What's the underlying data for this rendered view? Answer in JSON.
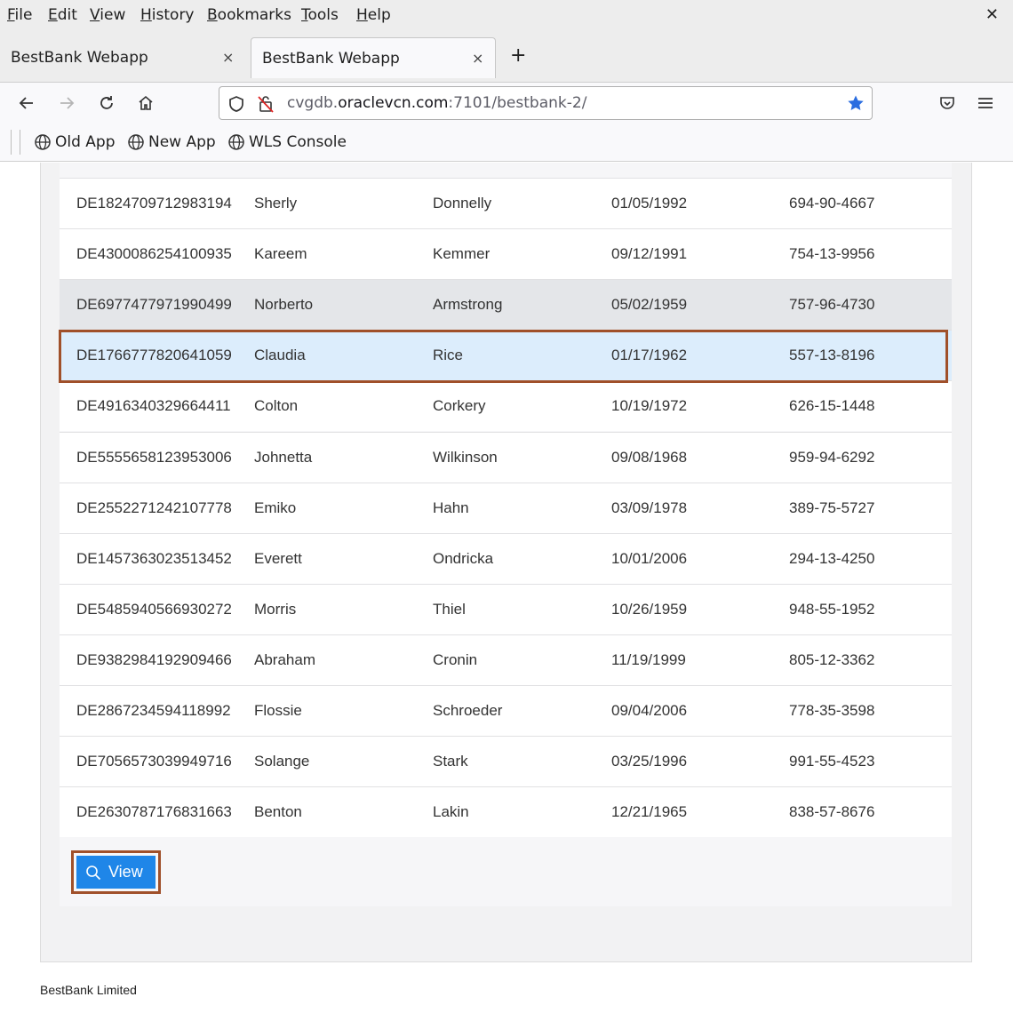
{
  "menubar": {
    "items": [
      "File",
      "Edit",
      "View",
      "History",
      "Bookmarks",
      "Tools",
      "Help"
    ],
    "close_glyph": "✕"
  },
  "tabs": [
    {
      "label": "BestBank Webapp",
      "active": false
    },
    {
      "label": "BestBank Webapp",
      "active": true
    }
  ],
  "tab_close_glyph": "×",
  "new_tab_glyph": "+",
  "urlbar": {
    "url_prefix": "cvgdb.",
    "url_host": "oraclevcn.com",
    "url_suffix": ":7101/bestbank-2/"
  },
  "bookmarks": [
    "Old App",
    "New App",
    "WLS Console"
  ],
  "table": {
    "rows": [
      [
        "DE1824709712983194",
        "Sherly",
        "Donnelly",
        "01/05/1992",
        "694-90-4667"
      ],
      [
        "DE4300086254100935",
        "Kareem",
        "Kemmer",
        "09/12/1991",
        "754-13-9956"
      ],
      [
        "DE6977477971990499",
        "Norberto",
        "Armstrong",
        "05/02/1959",
        "757-96-4730"
      ],
      [
        "DE1766777820641059",
        "Claudia",
        "Rice",
        "01/17/1962",
        "557-13-8196"
      ],
      [
        "DE4916340329664411",
        "Colton",
        "Corkery",
        "10/19/1972",
        "626-15-1448"
      ],
      [
        "DE5555658123953006",
        "Johnetta",
        "Wilkinson",
        "09/08/1968",
        "959-94-6292"
      ],
      [
        "DE2552271242107778",
        "Emiko",
        "Hahn",
        "03/09/1978",
        "389-75-5727"
      ],
      [
        "DE1457363023513452",
        "Everett",
        "Ondricka",
        "10/01/2006",
        "294-13-4250"
      ],
      [
        "DE5485940566930272",
        "Morris",
        "Thiel",
        "10/26/1959",
        "948-55-1952"
      ],
      [
        "DE9382984192909466",
        "Abraham",
        "Cronin",
        "11/19/1999",
        "805-12-3362"
      ],
      [
        "DE2867234594118992",
        "Flossie",
        "Schroeder",
        "09/04/2006",
        "778-35-3598"
      ],
      [
        "DE7056573039949716",
        "Solange",
        "Stark",
        "03/25/1996",
        "991-55-4523"
      ],
      [
        "DE2630787176831663",
        "Benton",
        "Lakin",
        "12/21/1965",
        "838-57-8676"
      ]
    ],
    "hover_row_index": 2,
    "selected_row_index": 3
  },
  "view_button": {
    "label": "View",
    "color": "#1f86e8"
  },
  "annotation_color": "#a0502a",
  "footer": {
    "text": "BestBank Limited"
  }
}
